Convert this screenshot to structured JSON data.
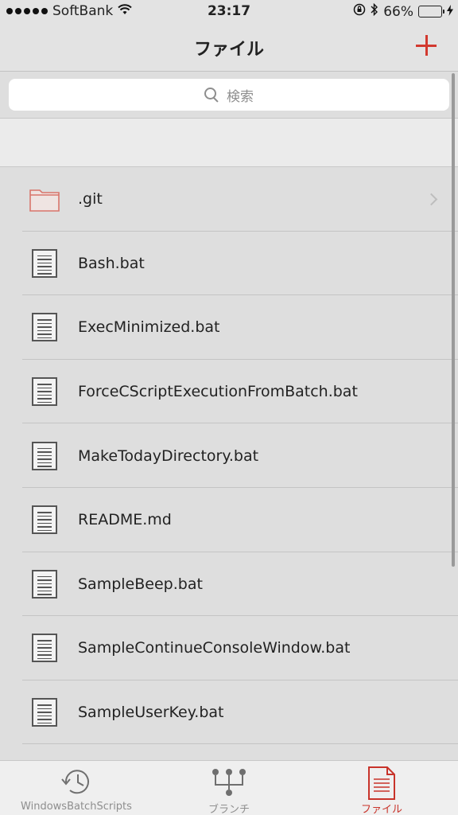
{
  "status_bar": {
    "carrier": "SoftBank",
    "time": "23:17",
    "battery_percent": "66%",
    "battery_level": 0.66
  },
  "nav": {
    "title": "ファイル",
    "add_icon": "plus-icon"
  },
  "search": {
    "placeholder": "検索"
  },
  "files": [
    {
      "name": ".git",
      "type": "folder"
    },
    {
      "name": "Bash.bat",
      "type": "file"
    },
    {
      "name": "ExecMinimized.bat",
      "type": "file"
    },
    {
      "name": "ForceCScriptExecutionFromBatch.bat",
      "type": "file"
    },
    {
      "name": "MakeTodayDirectory.bat",
      "type": "file"
    },
    {
      "name": "README.md",
      "type": "file"
    },
    {
      "name": "SampleBeep.bat",
      "type": "file"
    },
    {
      "name": "SampleContinueConsoleWindow.bat",
      "type": "file"
    },
    {
      "name": "SampleUserKey.bat",
      "type": "file"
    }
  ],
  "tabs": [
    {
      "label": "WindowsBatchScripts",
      "icon": "history-clock-icon",
      "active": false
    },
    {
      "label": "ブランチ",
      "icon": "branch-icon",
      "active": false
    },
    {
      "label": "ファイル",
      "icon": "document-icon",
      "active": true
    }
  ],
  "colors": {
    "accent": "#d2392f",
    "folder": "#d9756b",
    "battery": "#4cd964"
  }
}
